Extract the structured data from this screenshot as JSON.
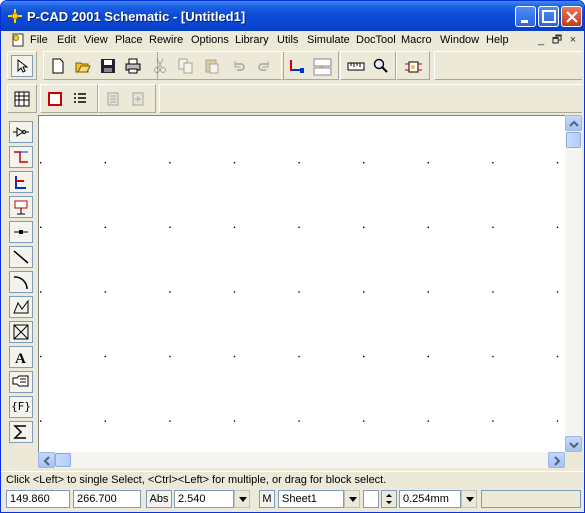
{
  "window": {
    "title": "P-CAD 2001 Schematic - [Untitled1]",
    "title_color": "#0a45cf"
  },
  "menu": {
    "items": [
      "File",
      "Edit",
      "View",
      "Place",
      "Rewire",
      "Options",
      "Library",
      "Utils",
      "Simulate",
      "DocTool",
      "Macro",
      "Window",
      "Help"
    ],
    "mdi_minimize": "_",
    "mdi_restore": "🗗",
    "mdi_close": "×"
  },
  "toolbar1": {
    "icons": [
      "select-arrow-icon",
      "new-icon",
      "open-icon",
      "save-icon",
      "print-icon",
      "cut-icon",
      "copy-icon",
      "paste-icon",
      "undo-icon",
      "redo-icon",
      "highlight-net-icon",
      "netlist-icon",
      "measure-icon",
      "zoom-icon",
      "component-icon"
    ]
  },
  "toolbar2": {
    "icons": [
      "spreadsheet-icon",
      "sheet-select-icon",
      "list-icon",
      "place-part-icon",
      "place-part2-icon"
    ]
  },
  "left_toolbar": {
    "icons": [
      "place-part-tool-icon",
      "place-wire-tool-icon",
      "place-bus-tool-icon",
      "place-port-tool-icon",
      "place-pin-tool-icon",
      "place-line-tool-icon",
      "place-arc-tool-icon",
      "place-polygon-tool-icon",
      "place-field-box-tool-icon",
      "place-text-tool-icon",
      "place-attribute-tool-icon",
      "place-field-tool-icon",
      "place-ieee-symbol-tool-icon"
    ],
    "field_label": "{F}"
  },
  "status": {
    "message": "Click <Left> to single Select, <Ctrl><Left> for multiple, or drag for block select.",
    "x_coord": "149.860",
    "y_coord": "266.700",
    "abs_label": "Abs",
    "grid": "2.540",
    "m_label": "M",
    "sheet": "Sheet1",
    "line_width": "0.254mm"
  }
}
